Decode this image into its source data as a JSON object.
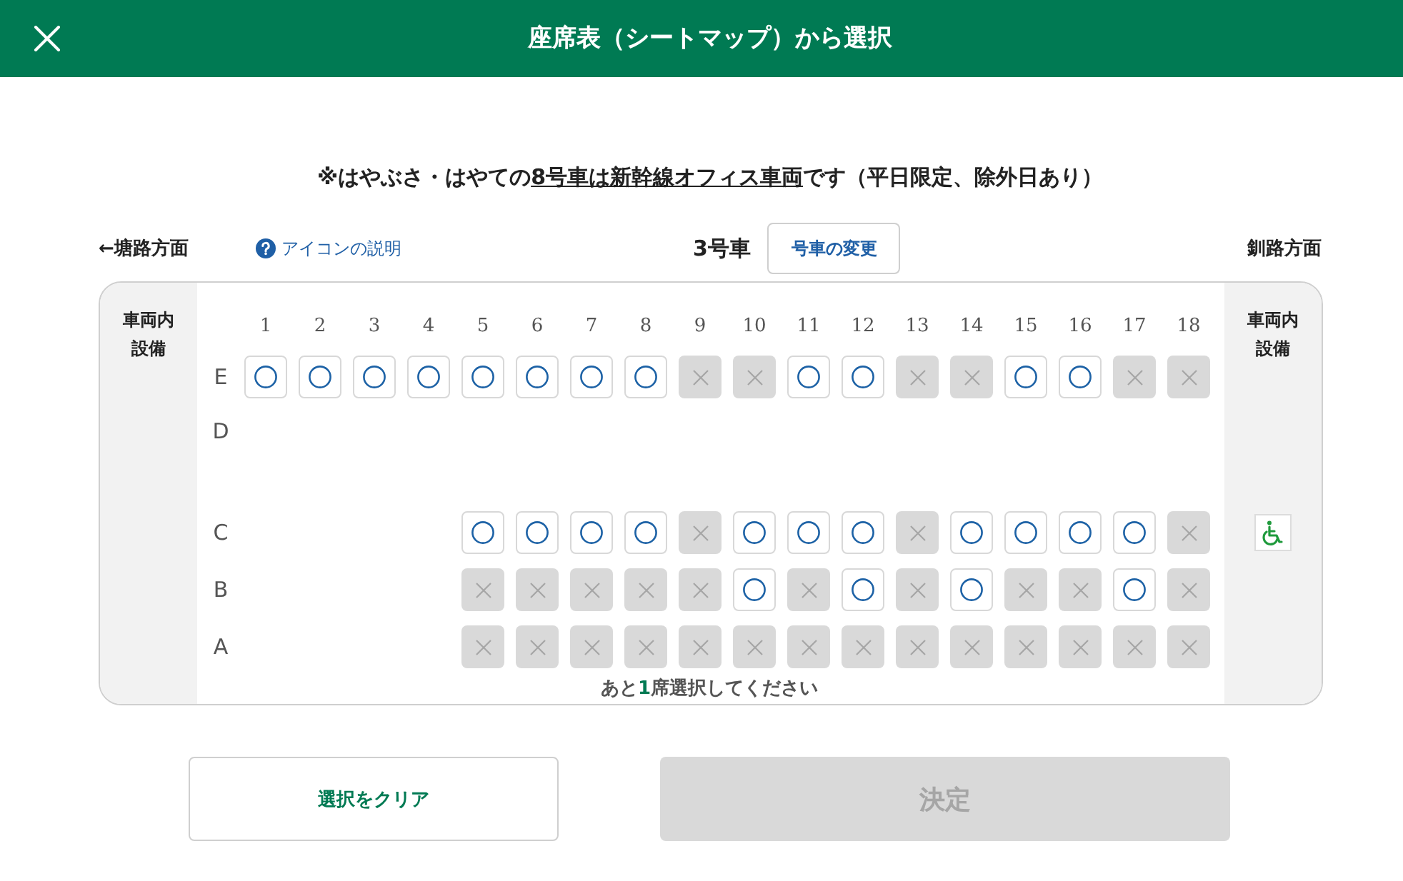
{
  "header": {
    "title": "座席表（シートマップ）から選択"
  },
  "notice": {
    "before": "※はやぶさ・はやての",
    "link": "8号車は新幹線オフィス車両",
    "after": "です（平日限定、除外日あり）"
  },
  "car_nav": {
    "direction_left": "←塘路方面",
    "legend_link": "アイコンの説明",
    "car": "3号車",
    "change_button": "号車の変更",
    "direction_right": "釧路方面"
  },
  "seat_map": {
    "left_facilities": {
      "heading": "車両内設備"
    },
    "right_facilities": {
      "heading": "車両内設備"
    },
    "columns": [
      "1",
      "2",
      "3",
      "4",
      "5",
      "6",
      "7",
      "8",
      "9",
      "10",
      "11",
      "12",
      "13",
      "14",
      "15",
      "16",
      "17",
      "18"
    ],
    "rows": [
      {
        "label": "E",
        "seats": [
          {
            "kind": "seat",
            "available": true
          },
          {
            "kind": "seat",
            "available": true
          },
          {
            "kind": "seat",
            "available": true
          },
          {
            "kind": "seat",
            "available": true
          },
          {
            "kind": "seat",
            "available": true
          },
          {
            "kind": "seat",
            "available": true
          },
          {
            "kind": "seat",
            "available": true
          },
          {
            "kind": "seat",
            "available": true
          },
          {
            "kind": "seat",
            "available": false
          },
          {
            "kind": "seat",
            "available": false
          },
          {
            "kind": "seat",
            "available": true
          },
          {
            "kind": "seat",
            "available": true
          },
          {
            "kind": "seat",
            "available": false
          },
          {
            "kind": "seat",
            "available": false
          },
          {
            "kind": "seat",
            "available": true
          },
          {
            "kind": "seat",
            "available": true
          },
          {
            "kind": "seat",
            "available": false
          },
          {
            "kind": "seat",
            "available": false
          }
        ]
      },
      {
        "label": "D"
      },
      {
        "label": "C",
        "facility": {
          "kind": "wheelchair"
        },
        "seats": [
          {
            "kind": "gap"
          },
          {
            "kind": "gap"
          },
          {
            "kind": "gap"
          },
          {
            "kind": "gap"
          },
          {
            "kind": "seat",
            "available": true
          },
          {
            "kind": "seat",
            "available": true
          },
          {
            "kind": "seat",
            "available": true
          },
          {
            "kind": "seat",
            "available": true
          },
          {
            "kind": "seat",
            "available": false
          },
          {
            "kind": "seat",
            "available": true
          },
          {
            "kind": "seat",
            "available": true
          },
          {
            "kind": "seat",
            "available": true
          },
          {
            "kind": "seat",
            "available": false
          },
          {
            "kind": "seat",
            "available": true
          },
          {
            "kind": "seat",
            "available": true
          },
          {
            "kind": "seat",
            "available": true
          },
          {
            "kind": "seat",
            "available": true
          },
          {
            "kind": "seat",
            "available": false
          }
        ]
      },
      {
        "label": "B",
        "seats": [
          {
            "kind": "gap"
          },
          {
            "kind": "gap"
          },
          {
            "kind": "gap"
          },
          {
            "kind": "gap"
          },
          {
            "kind": "seat",
            "available": false
          },
          {
            "kind": "seat",
            "available": false
          },
          {
            "kind": "seat",
            "available": false
          },
          {
            "kind": "seat",
            "available": false
          },
          {
            "kind": "seat",
            "available": false
          },
          {
            "kind": "seat",
            "available": true
          },
          {
            "kind": "seat",
            "available": false
          },
          {
            "kind": "seat",
            "available": true
          },
          {
            "kind": "seat",
            "available": false
          },
          {
            "kind": "seat",
            "available": true
          },
          {
            "kind": "seat",
            "available": false
          },
          {
            "kind": "seat",
            "available": false
          },
          {
            "kind": "seat",
            "available": true
          },
          {
            "kind": "seat",
            "available": false
          }
        ]
      },
      {
        "label": "A",
        "seats": [
          {
            "kind": "gap"
          },
          {
            "kind": "gap"
          },
          {
            "kind": "gap"
          },
          {
            "kind": "gap"
          },
          {
            "kind": "seat",
            "available": false
          },
          {
            "kind": "seat",
            "available": false
          },
          {
            "kind": "seat",
            "available": false
          },
          {
            "kind": "seat",
            "available": false
          },
          {
            "kind": "seat",
            "available": false
          },
          {
            "kind": "seat",
            "available": false
          },
          {
            "kind": "seat",
            "available": false
          },
          {
            "kind": "seat",
            "available": false
          },
          {
            "kind": "seat",
            "available": false
          },
          {
            "kind": "seat",
            "available": false
          },
          {
            "kind": "seat",
            "available": false
          },
          {
            "kind": "seat",
            "available": false
          },
          {
            "kind": "seat",
            "available": false
          },
          {
            "kind": "seat",
            "available": false
          }
        ]
      }
    ],
    "remaining_hint": {
      "before": "あと",
      "count": "1",
      "after": "席選択してください"
    }
  },
  "buttons": [
    {
      "kind": "secondary",
      "label": "選択をクリア",
      "disabled": false
    },
    {
      "kind": "primary",
      "label": "決定",
      "disabled": true
    }
  ]
}
